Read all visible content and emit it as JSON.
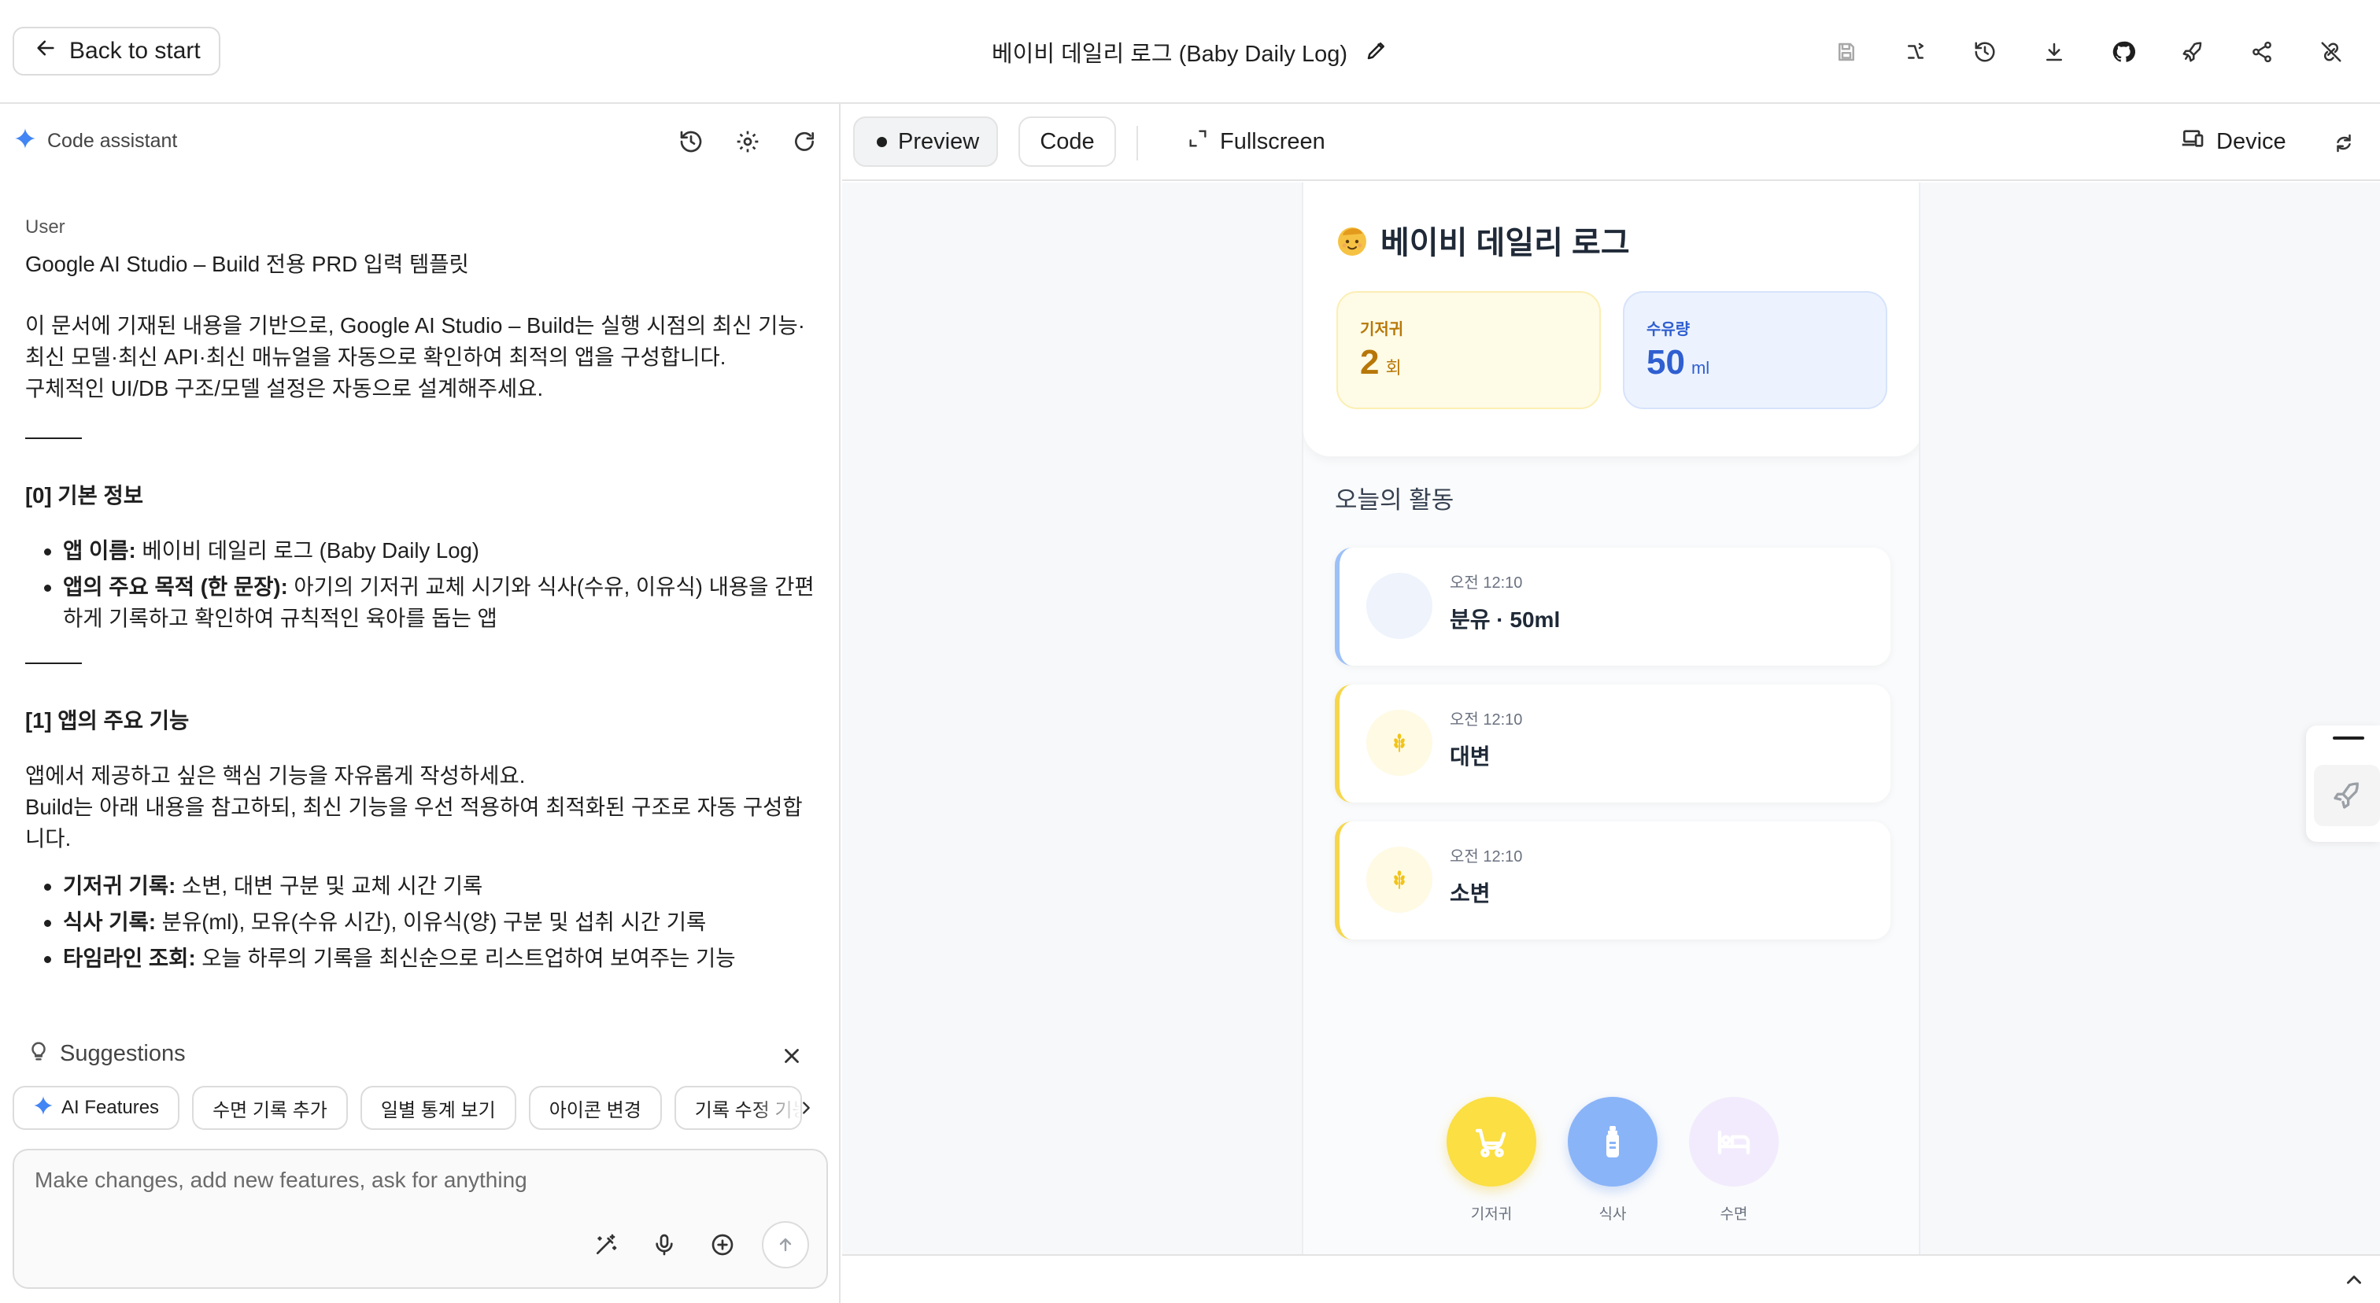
{
  "topbar": {
    "back_label": "Back to start",
    "app_title": "베이비 데일리 로그 (Baby Daily Log)"
  },
  "left": {
    "assistant_label": "Code assistant",
    "message": {
      "role": "User",
      "template_title": "Google AI Studio – Build 전용 PRD 입력 템플릿",
      "intro_1": "이 문서에 기재된 내용을 기반으로, Google AI Studio – Build는 실행 시점의 최신 기능·최신 모델·최신 API·최신 매뉴얼을 자동으로 확인하여 최적의 앱을 구성합니다.",
      "intro_2": "구체적인 UI/DB 구조/모델 설정은 자동으로 설계해주세요.",
      "section_0": "[0] 기본 정보",
      "app_name_label": "앱 이름:",
      "app_name_value": "베이비 데일리 로그 (Baby Daily Log)",
      "purpose_label": "앱의 주요 목적 (한 문장):",
      "purpose_value": "아기의 기저귀 교체 시기와 식사(수유, 이유식) 내용을 간편하게 기록하고 확인하여 규칙적인 육아를 돕는 앱",
      "section_1": "[1] 앱의 주요 기능",
      "features_intro_1": "앱에서 제공하고 싶은 핵심 기능을 자유롭게 작성하세요.",
      "features_intro_2": "Build는 아래 내용을 참고하되, 최신 기능을 우선 적용하여 최적화된 구조로 자동 구성합니다.",
      "f1_label": "기저귀 기록:",
      "f1_value": "소변, 대변 구분 및 교체 시간 기록",
      "f2_label": "식사 기록:",
      "f2_value": "분유(ml), 모유(수유 시간), 이유식(양) 구분 및 섭취 시간 기록",
      "f3_label": "타임라인 조회:",
      "f3_value": "오늘 하루의 기록을 최신순으로 리스트업하여 보여주는 기능"
    },
    "suggestions_label": "Suggestions",
    "chips": [
      "AI Features",
      "수면 기록 추가",
      "일별 통계 보기",
      "아이콘 변경",
      "기록 수정 기능"
    ],
    "composer_placeholder": "Make changes, add new features, ask for anything"
  },
  "right": {
    "tab_preview": "Preview",
    "tab_code": "Code",
    "fullscreen_label": "Fullscreen",
    "device_label": "Device"
  },
  "app": {
    "heading": "베이비 데일리 로그",
    "diaper_stat": {
      "label": "기저귀",
      "value": "2",
      "unit": "회"
    },
    "feed_stat": {
      "label": "수유량",
      "value": "50",
      "unit": "ml"
    },
    "activity_title": "오늘의 활동",
    "activities": [
      {
        "time": "오전 12:10",
        "name": "분유 · 50ml",
        "kind": "feed"
      },
      {
        "time": "오전 12:10",
        "name": "대변",
        "kind": "diaper"
      },
      {
        "time": "오전 12:10",
        "name": "소변",
        "kind": "diaper"
      }
    ],
    "fabs": [
      {
        "label": "기저귀",
        "icon": "stroller-icon",
        "color": "#fbdf43"
      },
      {
        "label": "식사",
        "icon": "bottle-icon",
        "color": "#8ab4f8"
      },
      {
        "label": "수면",
        "icon": "bed-icon",
        "color": "#f2ebfd"
      }
    ]
  },
  "colors": {
    "accent_blue": "#4285f4",
    "diaper_yellow": "#fbdf43",
    "feed_blue": "#8ab4f8",
    "sleep_lavender": "#f2ebfd"
  }
}
